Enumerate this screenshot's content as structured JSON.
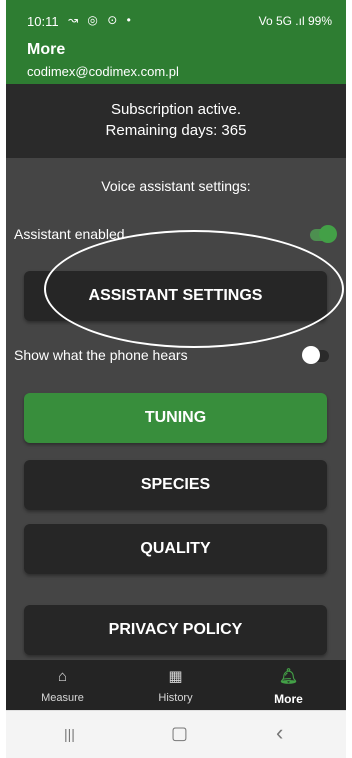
{
  "status_bar": {
    "time": "10:11",
    "left_icons": "↝ ◎ ⊙ •",
    "right_icons": "Vo 5G .ıl 99%",
    "battery_level_percent": 99
  },
  "app_bar": {
    "title": "More",
    "account_email": "codimex@codimex.com.pl"
  },
  "subscription": {
    "line1": "Subscription active.",
    "line2": "Remaining days: 365"
  },
  "voice_settings": {
    "heading": "Voice assistant settings:",
    "assistant_enabled_label": "Assistant enabled",
    "assistant_enabled": true,
    "assistant_settings_button": "ASSISTANT SETTINGS",
    "show_hears_label": "Show what the phone hears",
    "show_hears": false
  },
  "buttons": {
    "tuning": "TUNING",
    "species": "SPECIES",
    "quality": "QUALITY",
    "privacy_policy": "PRIVACY POLICY"
  },
  "bottom_nav": {
    "items": [
      {
        "label": "Measure",
        "icon": "home-icon",
        "glyph": "⌂",
        "active": false
      },
      {
        "label": "History",
        "icon": "grid-icon",
        "glyph": "▦",
        "active": false
      },
      {
        "label": "More",
        "icon": "bell-icon",
        "glyph": "🔔︎",
        "active": true
      }
    ]
  },
  "system_nav": {
    "recents_glyph": "|||",
    "home_glyph": "▢",
    "back_glyph": "‹"
  },
  "colors": {
    "accent_green": "#2e7d32",
    "button_green": "#388e3c",
    "background": "#454545",
    "dark_panel": "#2a2a2a"
  }
}
